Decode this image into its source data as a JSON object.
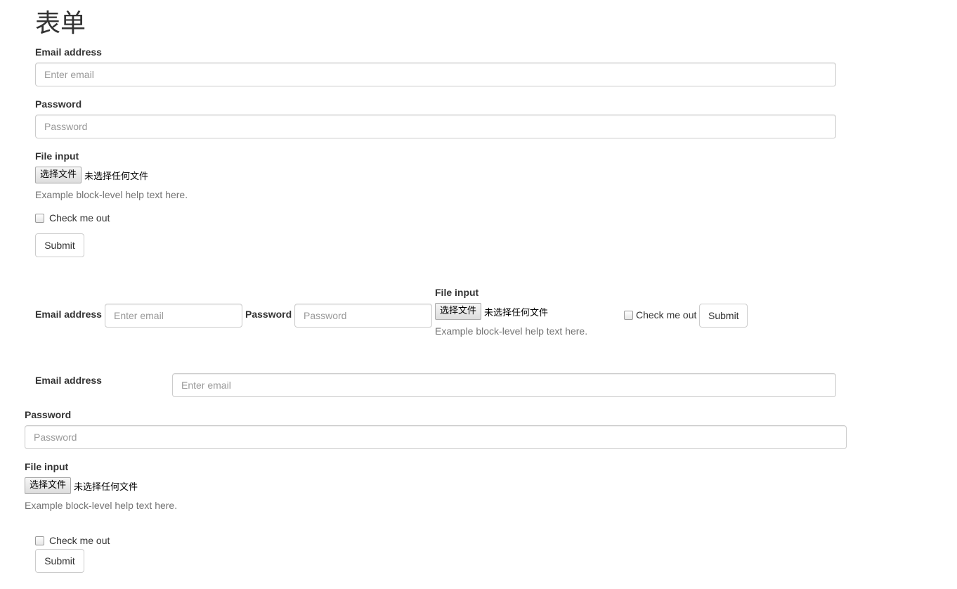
{
  "page": {
    "title": "表单"
  },
  "form_basic": {
    "email_label": "Email address",
    "email_placeholder": "Enter email",
    "password_label": "Password",
    "password_placeholder": "Password",
    "file_label": "File input",
    "file_button": "选择文件",
    "file_status": "未选择任何文件",
    "help_text": "Example block-level help text here.",
    "checkbox_label": "Check me out",
    "submit_label": "Submit"
  },
  "form_inline": {
    "email_label": "Email address",
    "email_placeholder": "Enter email",
    "password_label": "Password",
    "password_placeholder": "Password",
    "file_label": "File input",
    "file_button": "选择文件",
    "file_status": "未选择任何文件",
    "help_text": "Example block-level help text here.",
    "checkbox_label": "Check me out",
    "submit_label": "Submit"
  },
  "form_horizontal": {
    "email_label": "Email address",
    "email_placeholder": "Enter email",
    "password_label": "Password",
    "password_placeholder": "Password",
    "file_label": "File input",
    "file_button": "选择文件",
    "file_status": "未选择任何文件",
    "help_text": "Example block-level help text here.",
    "checkbox_label": "Check me out",
    "submit_label": "Submit"
  },
  "colors": {
    "text": "#333333",
    "placeholder": "#999999",
    "help_text": "#737373",
    "border": "#cccccc"
  }
}
